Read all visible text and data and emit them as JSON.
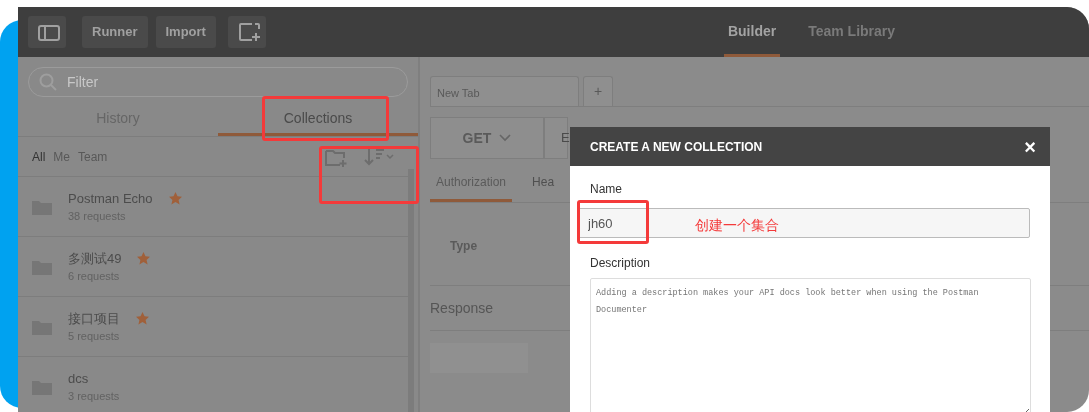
{
  "toolbar": {
    "buttons": [
      "Runner",
      "Import"
    ],
    "tabs": [
      {
        "label": "Builder",
        "selected": true
      },
      {
        "label": "Team Library",
        "selected": false
      }
    ]
  },
  "sidebar": {
    "filter_placeholder": "Filter",
    "tabs": [
      {
        "label": "History",
        "selected": false
      },
      {
        "label": "Collections",
        "selected": true
      }
    ],
    "scopes": [
      {
        "label": "All",
        "selected": true
      },
      {
        "label": "Me",
        "selected": false
      },
      {
        "label": "Team",
        "selected": false
      }
    ],
    "collections": [
      {
        "name": "Postman Echo",
        "count": "38 requests",
        "starred": true
      },
      {
        "name": "多测试49",
        "count": "6 requests",
        "starred": true
      },
      {
        "name": "接口项目",
        "count": "5 requests",
        "starred": true
      },
      {
        "name": "dcs",
        "count": "3 requests",
        "starred": false
      }
    ]
  },
  "request": {
    "tabs": [
      {
        "label": "New Tab"
      }
    ],
    "add_tab": "+",
    "method": "GET",
    "url_placeholder": "E",
    "subtabs": [
      {
        "label": "Authorization",
        "selected": true
      },
      {
        "label": "Hea",
        "selected": false
      }
    ],
    "type_label": "Type",
    "response_label": "Response"
  },
  "modal": {
    "title": "CREATE A NEW COLLECTION",
    "close": "×",
    "name_label": "Name",
    "name_value": "jh60",
    "description_label": "Description",
    "description_placeholder": "Adding a description makes your API docs look better when using the Postman Documenter"
  },
  "annotation": {
    "note": "创建一个集合"
  }
}
